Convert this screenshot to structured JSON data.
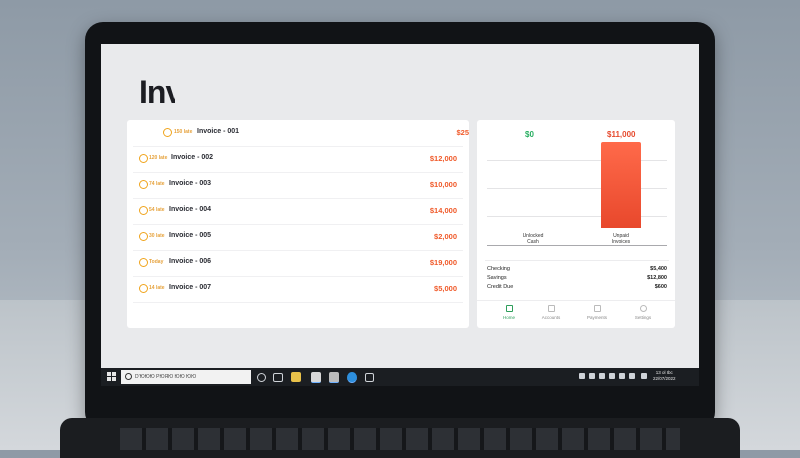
{
  "app": {
    "title": "Inv"
  },
  "invoices": [
    {
      "due": "150 late",
      "name": "Invoice - 001",
      "amount": "$25"
    },
    {
      "due": "120 late",
      "name": "Invoice - 002",
      "amount": "$12,000"
    },
    {
      "due": "74 late",
      "name": "Invoice - 003",
      "amount": "$10,000"
    },
    {
      "due": "54 late",
      "name": "Invoice - 004",
      "amount": "$14,000"
    },
    {
      "due": "30 late",
      "name": "Invoice - 005",
      "amount": "$2,000"
    },
    {
      "due": "Today",
      "name": "Invoice - 006",
      "amount": "$19,000"
    },
    {
      "due": "14 late",
      "name": "Invoice - 007",
      "amount": "$5,000"
    }
  ],
  "summary": {
    "chart_data": {
      "type": "bar",
      "categories": [
        "Unlocked Cash",
        "Unpaid Invoices"
      ],
      "values": [
        0,
        11000
      ],
      "value_labels": [
        "$0",
        "$11,000"
      ],
      "colors": [
        "#27ae60",
        "#e64a2e"
      ]
    },
    "cat_left_line1": "Unlocked",
    "cat_left_line2": "Cash",
    "cat_right_line1": "Unpaid",
    "cat_right_line2": "Invoices",
    "accounts": [
      {
        "label": "Checking",
        "value": "$5,400"
      },
      {
        "label": "Savings",
        "value": "$12,800"
      },
      {
        "label": "Credit Due",
        "value": "$600"
      }
    ],
    "tabs": [
      "Home",
      "Accounts",
      "Payments",
      "Settings"
    ]
  },
  "taskbar": {
    "search_placeholder": "D'ЮЮЮ РЮЯЮ ЮЮ ЮЮ",
    "clock_time": "13 ol Ibc",
    "clock_date": "22/07/2022"
  }
}
